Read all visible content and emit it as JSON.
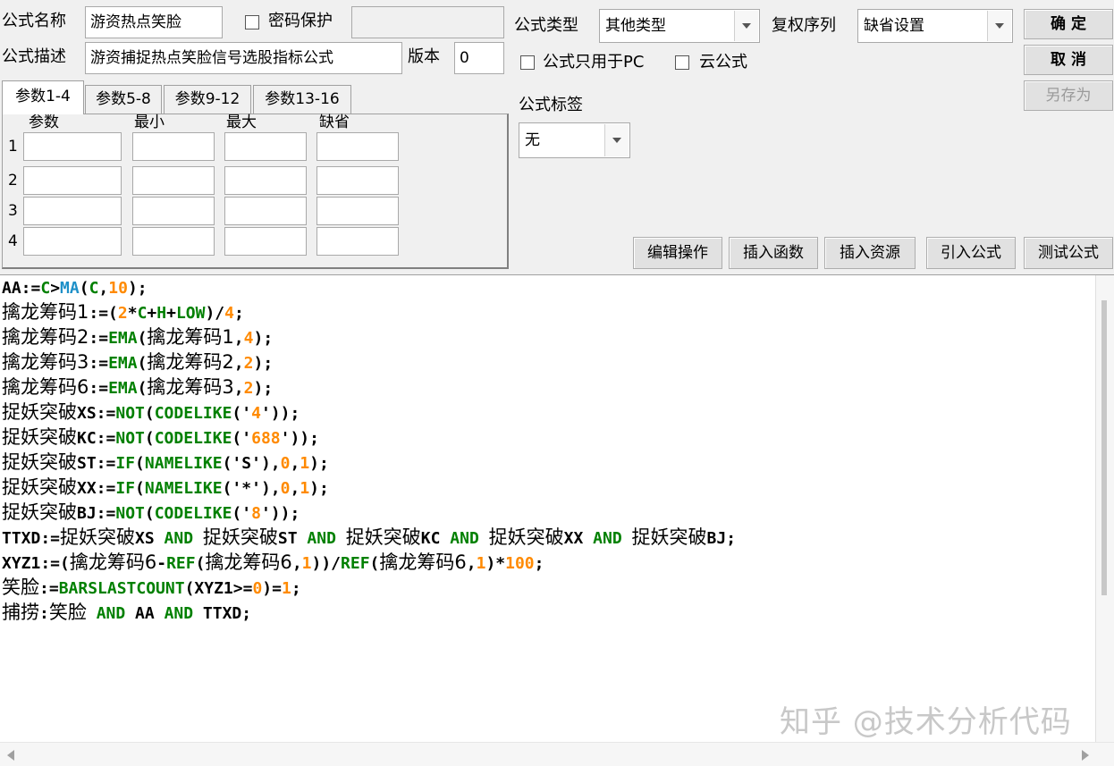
{
  "header": {
    "name_label": "公式名称",
    "name_value": "游资热点笑脸",
    "password_label": "密码保护",
    "password_value": "",
    "desc_label": "公式描述",
    "desc_value": "游资捕捉热点笑脸信号选股指标公式",
    "version_label": "版本",
    "version_value": "0",
    "type_label": "公式类型",
    "type_value": "其他类型",
    "rights_label": "复权序列",
    "rights_value": "缺省设置",
    "pc_only_label": "公式只用于PC",
    "cloud_label": "云公式",
    "tag_label": "公式标签",
    "tag_value": "无"
  },
  "buttons": {
    "ok": "确  定",
    "cancel": "取  消",
    "save_as": "另存为",
    "edit": "编辑操作",
    "insert_func": "插入函数",
    "insert_res": "插入资源",
    "import": "引入公式",
    "test": "测试公式"
  },
  "params": {
    "tabs": [
      "参数1-4",
      "参数5-8",
      "参数9-12",
      "参数13-16"
    ],
    "columns": [
      "参数",
      "最小",
      "最大",
      "缺省"
    ],
    "rows": [
      "1",
      "2",
      "3",
      "4"
    ]
  },
  "code_lines": [
    [
      [
        "AA:=",
        ""
      ],
      [
        "C",
        "g"
      ],
      [
        ">",
        ""
      ],
      [
        "MA",
        "b"
      ],
      [
        "(",
        ""
      ],
      [
        "C",
        "g"
      ],
      [
        ",",
        ""
      ],
      [
        "10",
        "o"
      ],
      [
        ");",
        ""
      ]
    ],
    [
      [
        "擒龙筹码1",
        "cjk"
      ],
      [
        ":=(",
        ""
      ],
      [
        "2",
        "o"
      ],
      [
        "*",
        ""
      ],
      [
        "C",
        "g"
      ],
      [
        "+",
        ""
      ],
      [
        "H",
        "g"
      ],
      [
        "+",
        ""
      ],
      [
        "LOW",
        "g"
      ],
      [
        ")/",
        ""
      ],
      [
        "4",
        "o"
      ],
      [
        ";",
        ""
      ]
    ],
    [
      [
        "擒龙筹码2",
        "cjk"
      ],
      [
        ":=",
        ""
      ],
      [
        "EMA",
        "g"
      ],
      [
        "(",
        ""
      ],
      [
        "擒龙筹码1",
        "cjk"
      ],
      [
        ",",
        ""
      ],
      [
        "4",
        "o"
      ],
      [
        ");",
        ""
      ]
    ],
    [
      [
        "擒龙筹码3",
        "cjk"
      ],
      [
        ":=",
        ""
      ],
      [
        "EMA",
        "g"
      ],
      [
        "(",
        ""
      ],
      [
        "擒龙筹码2",
        "cjk"
      ],
      [
        ",",
        ""
      ],
      [
        "2",
        "o"
      ],
      [
        ");",
        ""
      ]
    ],
    [
      [
        "擒龙筹码6",
        "cjk"
      ],
      [
        ":=",
        ""
      ],
      [
        "EMA",
        "g"
      ],
      [
        "(",
        ""
      ],
      [
        "擒龙筹码3",
        "cjk"
      ],
      [
        ",",
        ""
      ],
      [
        "2",
        "o"
      ],
      [
        ");",
        ""
      ]
    ],
    [
      [
        "捉妖突破",
        "cjk"
      ],
      [
        "XS:=",
        ""
      ],
      [
        "NOT",
        "g"
      ],
      [
        "(",
        ""
      ],
      [
        "CODELIKE",
        "g"
      ],
      [
        "('",
        ""
      ],
      [
        "4",
        "o"
      ],
      [
        "'));",
        ""
      ]
    ],
    [
      [
        "捉妖突破",
        "cjk"
      ],
      [
        "KC:=",
        ""
      ],
      [
        "NOT",
        "g"
      ],
      [
        "(",
        ""
      ],
      [
        "CODELIKE",
        "g"
      ],
      [
        "('",
        ""
      ],
      [
        "688",
        "o"
      ],
      [
        "'));",
        ""
      ]
    ],
    [
      [
        "捉妖突破",
        "cjk"
      ],
      [
        "ST:=",
        ""
      ],
      [
        "IF",
        "g"
      ],
      [
        "(",
        ""
      ],
      [
        "NAMELIKE",
        "g"
      ],
      [
        "('S'),",
        ""
      ],
      [
        "0",
        "o"
      ],
      [
        ",",
        ""
      ],
      [
        "1",
        "o"
      ],
      [
        ");",
        ""
      ]
    ],
    [
      [
        "捉妖突破",
        "cjk"
      ],
      [
        "XX:=",
        ""
      ],
      [
        "IF",
        "g"
      ],
      [
        "(",
        ""
      ],
      [
        "NAMELIKE",
        "g"
      ],
      [
        "('*'),",
        ""
      ],
      [
        "0",
        "o"
      ],
      [
        ",",
        ""
      ],
      [
        "1",
        "o"
      ],
      [
        ");",
        ""
      ]
    ],
    [
      [
        "捉妖突破",
        "cjk"
      ],
      [
        "BJ:=",
        ""
      ],
      [
        "NOT",
        "g"
      ],
      [
        "(",
        ""
      ],
      [
        "CODELIKE",
        "g"
      ],
      [
        "('",
        ""
      ],
      [
        "8",
        "o"
      ],
      [
        "'));",
        ""
      ]
    ],
    [
      [
        "TTXD:=",
        ""
      ],
      [
        "捉妖突破",
        "cjk"
      ],
      [
        "XS ",
        ""
      ],
      [
        "AND",
        "g"
      ],
      [
        " ",
        ""
      ],
      [
        "捉妖突破",
        "cjk"
      ],
      [
        "ST ",
        ""
      ],
      [
        "AND",
        "g"
      ],
      [
        " ",
        ""
      ],
      [
        "捉妖突破",
        "cjk"
      ],
      [
        "KC ",
        ""
      ],
      [
        "AND",
        "g"
      ],
      [
        " ",
        ""
      ],
      [
        "捉妖突破",
        "cjk"
      ],
      [
        "XX ",
        ""
      ],
      [
        "AND",
        "g"
      ],
      [
        " ",
        ""
      ],
      [
        "捉妖突破",
        "cjk"
      ],
      [
        "BJ;",
        ""
      ]
    ],
    [
      [
        "XYZ1:=(",
        ""
      ],
      [
        "擒龙筹码6",
        "cjk"
      ],
      [
        "-",
        ""
      ],
      [
        "REF",
        "g"
      ],
      [
        "(",
        ""
      ],
      [
        "擒龙筹码6",
        "cjk"
      ],
      [
        ",",
        ""
      ],
      [
        "1",
        "o"
      ],
      [
        "))/",
        ""
      ],
      [
        "REF",
        "g"
      ],
      [
        "(",
        ""
      ],
      [
        "擒龙筹码6",
        "cjk"
      ],
      [
        ",",
        ""
      ],
      [
        "1",
        "o"
      ],
      [
        ")*",
        ""
      ],
      [
        "100",
        "o"
      ],
      [
        ";",
        ""
      ]
    ],
    [
      [
        "笑脸",
        "cjk"
      ],
      [
        ":=",
        ""
      ],
      [
        "BARSLASTCOUNT",
        "g"
      ],
      [
        "(XYZ1>=",
        ""
      ],
      [
        "0",
        "o"
      ],
      [
        ")=",
        ""
      ],
      [
        "1",
        "o"
      ],
      [
        ";",
        ""
      ]
    ],
    [
      [
        "捕捞",
        "cjk"
      ],
      [
        ":",
        ""
      ],
      [
        "笑脸",
        "cjk"
      ],
      [
        " ",
        ""
      ],
      [
        "AND",
        "g"
      ],
      [
        " AA ",
        ""
      ],
      [
        "AND",
        "g"
      ],
      [
        " TTXD;",
        ""
      ]
    ]
  ],
  "watermark": "知乎 @技术分析代码"
}
